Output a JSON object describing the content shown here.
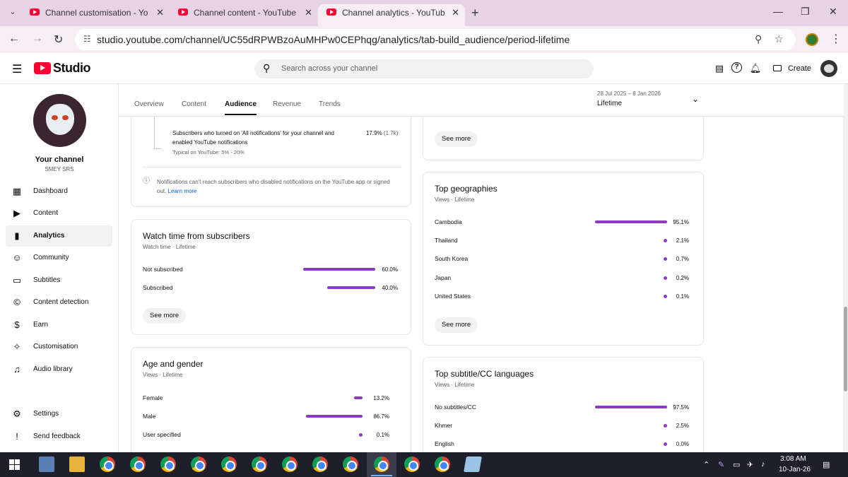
{
  "browser": {
    "tabs": [
      {
        "title": "Channel customisation - YouTube Studio"
      },
      {
        "title": "Channel content - YouTube Studio"
      },
      {
        "title": "Channel analytics - YouTube Studio"
      }
    ],
    "url": "studio.youtube.com/channel/UC55dRPWBzoAuMHPw0CEPhqg/analytics/tab-build_audience/period-lifetime"
  },
  "header": {
    "logo_text": "Studio",
    "search_placeholder": "Search across your channel",
    "create_label": "Create"
  },
  "sidebar": {
    "channel_label": "Your channel",
    "channel_handle": "SMEY SRS",
    "items": [
      {
        "label": "Dashboard",
        "icon": "dashboard-icon"
      },
      {
        "label": "Content",
        "icon": "content-icon"
      },
      {
        "label": "Analytics",
        "icon": "analytics-icon"
      },
      {
        "label": "Community",
        "icon": "community-icon"
      },
      {
        "label": "Subtitles",
        "icon": "subtitles-icon"
      },
      {
        "label": "Content detection",
        "icon": "copyright-icon"
      },
      {
        "label": "Earn",
        "icon": "dollar-icon"
      },
      {
        "label": "Customisation",
        "icon": "wand-icon"
      },
      {
        "label": "Audio library",
        "icon": "audio-library-icon"
      }
    ],
    "bottom_items": [
      {
        "label": "Settings",
        "icon": "gear-icon"
      },
      {
        "label": "Send feedback",
        "icon": "feedback-icon"
      }
    ]
  },
  "analytics_tabs": [
    "Overview",
    "Content",
    "Audience",
    "Revenue",
    "Trends"
  ],
  "date": {
    "range": "28 Jul 2025 – 8 Jan 2026",
    "period": "Lifetime"
  },
  "notifications_card": {
    "row_label": "Subscribers who turned on 'All notifications' for your channel and enabled YouTube notifications",
    "typical": "Typical on YouTube: 5% - 20%",
    "value": "17.9%",
    "count": "(1.7k)",
    "note": "Notifications can't reach subscribers who disabled notifications on the YouTube app or signed out.",
    "learn_more": "Learn more"
  },
  "watch_time_card": {
    "title": "Watch time from subscribers",
    "subtitle": "Watch time · Lifetime",
    "rows": [
      {
        "label": "Not subscribed",
        "value": "60.0%",
        "pct": 60.0
      },
      {
        "label": "Subscribed",
        "value": "40.0%",
        "pct": 40.0
      }
    ],
    "see_more": "See more"
  },
  "age_gender_card": {
    "title": "Age and gender",
    "subtitle": "Views · Lifetime",
    "rows": [
      {
        "label": "Female",
        "value": "13.2%",
        "pct": 13.2
      },
      {
        "label": "Male",
        "value": "86.7%",
        "pct": 86.7
      },
      {
        "label": "User specified",
        "value": "0.1%",
        "pct": 0.1
      }
    ]
  },
  "top_right_card": {
    "see_more": "See more"
  },
  "geographies_card": {
    "title": "Top geographies",
    "subtitle": "Views · Lifetime",
    "rows": [
      {
        "label": "Cambodia",
        "value": "95.1%",
        "pct": 95.1
      },
      {
        "label": "Thailand",
        "value": "2.1%",
        "pct": 2.1
      },
      {
        "label": "South Korea",
        "value": "0.7%",
        "pct": 0.7
      },
      {
        "label": "Japan",
        "value": "0.2%",
        "pct": 0.2
      },
      {
        "label": "United States",
        "value": "0.1%",
        "pct": 0.1
      }
    ],
    "see_more": "See more"
  },
  "subtitle_card": {
    "title": "Top subtitle/CC languages",
    "subtitle": "Views · Lifetime",
    "rows": [
      {
        "label": "No subtitles/CC",
        "value": "97.5%",
        "pct": 97.5
      },
      {
        "label": "Khmer",
        "value": "2.5%",
        "pct": 2.5
      },
      {
        "label": "English",
        "value": "0.0%",
        "pct": 0.0
      }
    ]
  },
  "taskbar": {
    "time": "3:08 AM",
    "date": "10-Jan-26"
  },
  "colors": {
    "accent_bar": "#8d3bbf",
    "brand_red": "#ff0033"
  }
}
